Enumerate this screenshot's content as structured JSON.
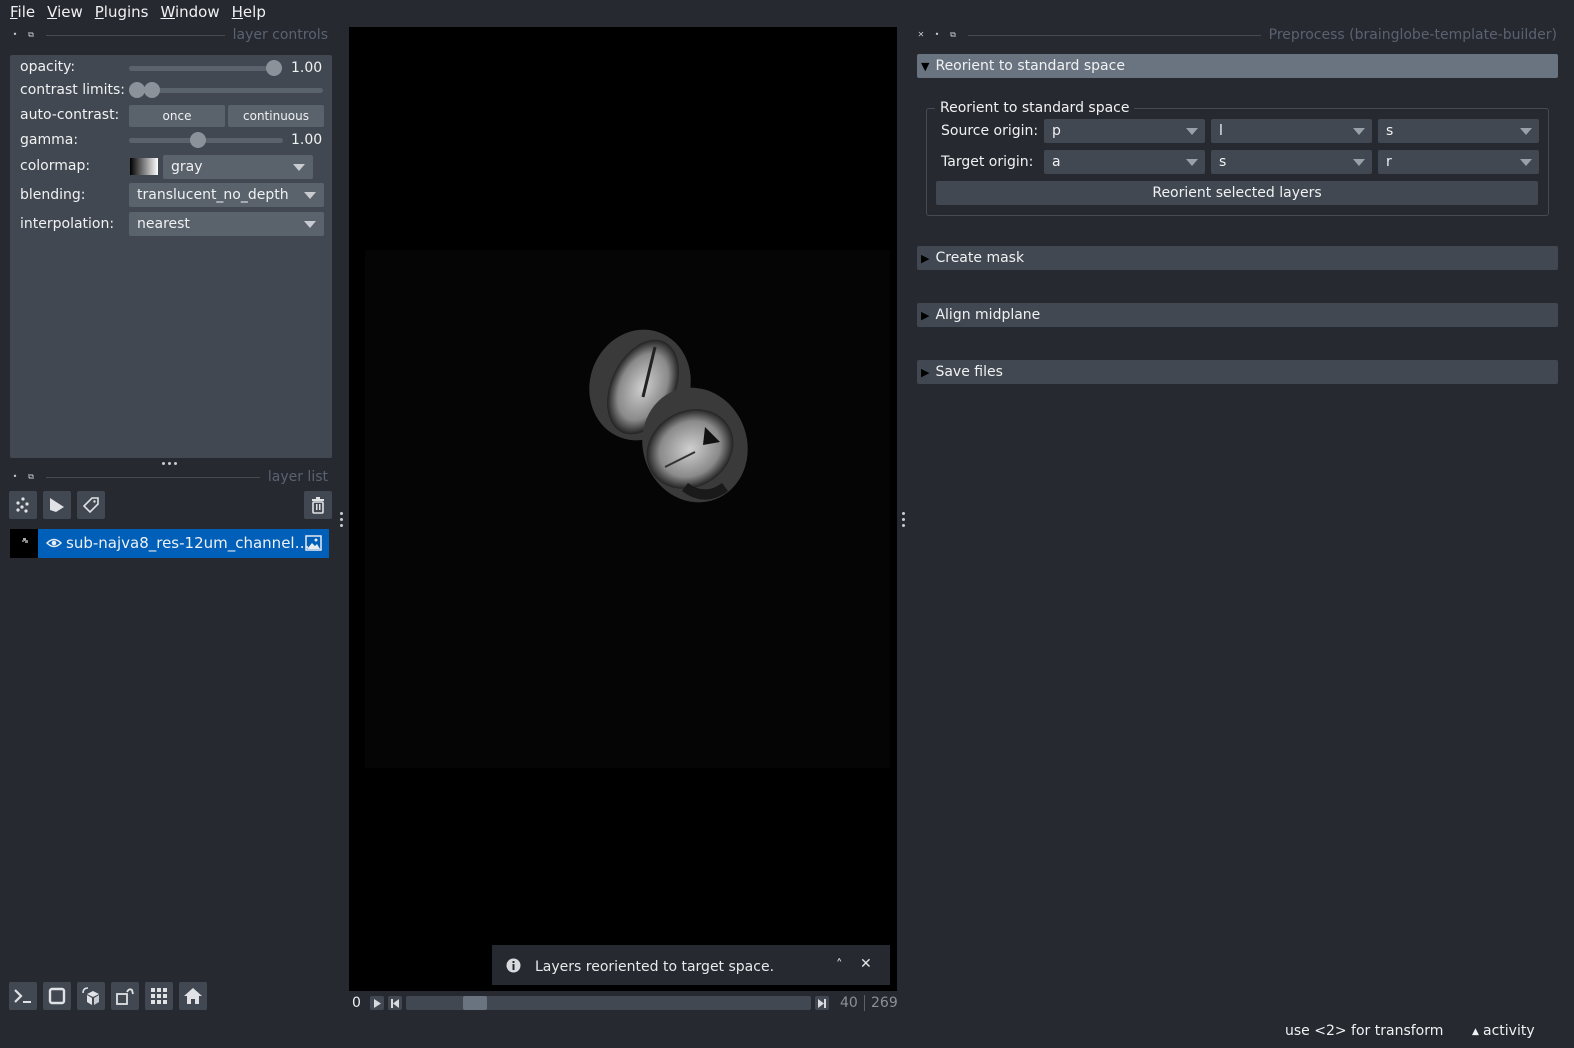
{
  "menubar": {
    "items": [
      {
        "label": "File",
        "mnemonic": "F",
        "rest": "ile"
      },
      {
        "label": "View",
        "mnemonic": "V",
        "rest": "iew"
      },
      {
        "label": "Plugins",
        "mnemonic": "P",
        "rest": "lugins"
      },
      {
        "label": "Window",
        "mnemonic": "W",
        "rest": "indow"
      },
      {
        "label": "Help",
        "mnemonic": "H",
        "rest": "elp"
      }
    ]
  },
  "layer_controls": {
    "title": "layer controls",
    "opacity": {
      "label": "opacity:",
      "value": "1.00",
      "fraction": 1.0
    },
    "contrast_limits": {
      "label": "contrast limits:",
      "low_fraction": 0.0,
      "high_fraction": 0.04
    },
    "auto_contrast": {
      "label": "auto-contrast:",
      "once": "once",
      "continuous": "continuous"
    },
    "gamma": {
      "label": "gamma:",
      "value": "1.00",
      "fraction": 0.45
    },
    "colormap": {
      "label": "colormap:",
      "value": "gray"
    },
    "blending": {
      "label": "blending:",
      "value": "translucent_no_depth"
    },
    "interpolation": {
      "label": "interpolation:",
      "value": "nearest"
    }
  },
  "layer_list": {
    "title": "layer list",
    "layers": [
      {
        "name": "sub-najva8_res-12um_channel…",
        "visible": true,
        "type": "image",
        "selected": true
      }
    ]
  },
  "viewer": {
    "notification": {
      "text": "Layers reoriented to target space."
    },
    "dims": {
      "start": "0",
      "current": "40",
      "max": "269",
      "fraction": 0.15
    }
  },
  "plugin_dock": {
    "title": "Preprocess (brainglobe-template-builder)",
    "sections": [
      {
        "label": "Reorient to standard space",
        "expanded": true
      },
      {
        "label": "Create mask",
        "expanded": false
      },
      {
        "label": "Align midplane",
        "expanded": false
      },
      {
        "label": "Save files",
        "expanded": false
      }
    ],
    "reorient": {
      "group_title": "Reorient to standard space",
      "source_label": "Source origin:",
      "target_label": "Target origin:",
      "source": [
        "p",
        "l",
        "s"
      ],
      "target": [
        "a",
        "s",
        "r"
      ],
      "button": "Reorient selected layers"
    }
  },
  "statusbar": {
    "hint": "use <2> for transform",
    "activity": "activity"
  }
}
